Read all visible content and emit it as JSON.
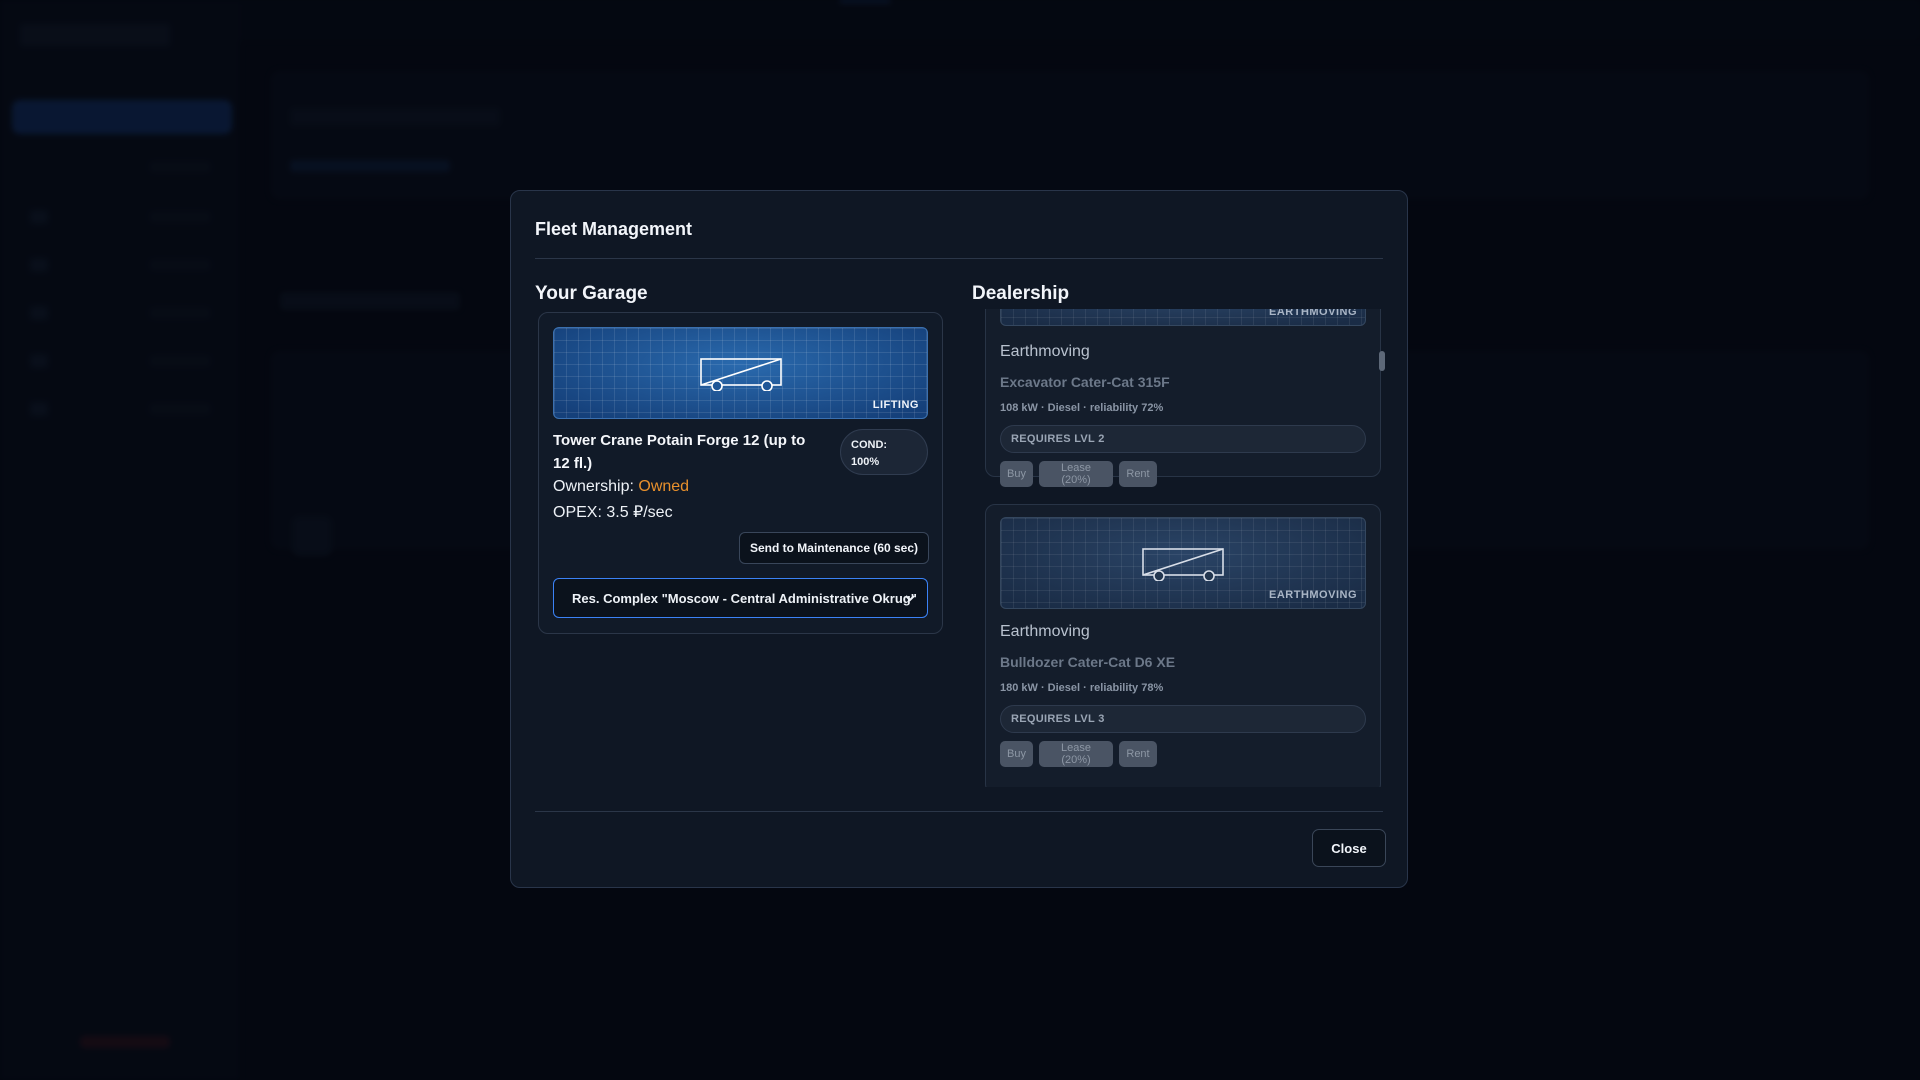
{
  "modal": {
    "title": "Fleet Management",
    "close_label": "Close"
  },
  "garage": {
    "title": "Your Garage",
    "vehicle": {
      "category_tag": "LIFTING",
      "name": "Tower Crane Potain Forge 12 (up to 12 fl.)",
      "condition_label": "COND:",
      "condition_value": "100%",
      "ownership_label": "Ownership:",
      "ownership_value": "Owned",
      "opex_text": "OPEX: 3.5 ₽/sec",
      "maintenance_label": "Send to Maintenance (60 sec)",
      "assignment": "Res. Complex \"Moscow - Central Administrative Okrug\""
    }
  },
  "dealership": {
    "title": "Dealership",
    "items": [
      {
        "tag": "EARTHMOVING",
        "category": "Earthmoving",
        "model": "Excavator Cater-Cat 315F",
        "specs": "108 kW · Diesel · reliability 72%",
        "requirement": "REQUIRES LVL 2",
        "buy_label": "Buy",
        "lease_label": "Lease (20%)",
        "rent_label": "Rent"
      },
      {
        "tag": "EARTHMOVING",
        "category": "Earthmoving",
        "model": "Bulldozer Cater-Cat D6 XE",
        "specs": "180 kW · Diesel · reliability 78%",
        "requirement": "REQUIRES LVL 3",
        "buy_label": "Buy",
        "lease_label": "Lease (20%)",
        "rent_label": "Rent"
      }
    ]
  },
  "colors": {
    "accent": "#3b82f6",
    "owned": "#e8902c",
    "modal_bg": "#0f1724"
  },
  "icons": {
    "vehicle": "vehicle-trailer-icon",
    "dropdown": "chevron-down-icon"
  }
}
